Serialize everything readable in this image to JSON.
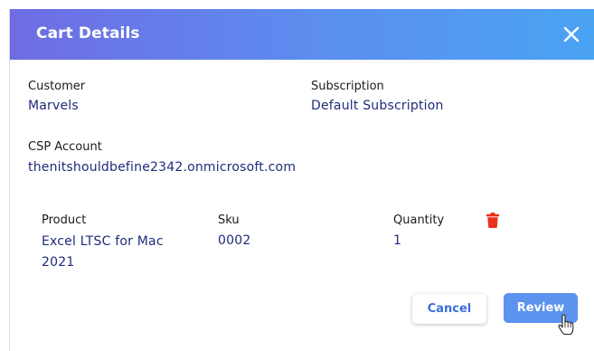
{
  "dialog": {
    "title": "Cart Details",
    "close_icon": "close-icon"
  },
  "customer": {
    "label": "Customer",
    "value": "Marvels"
  },
  "subscription": {
    "label": "Subscription",
    "value": "Default Subscription"
  },
  "csp_account": {
    "label": "CSP Account",
    "value": "thenitshouldbefine2342.onmicrosoft.com"
  },
  "items_table": {
    "headers": {
      "product": "Product",
      "sku": "Sku",
      "quantity": "Quantity"
    },
    "rows": [
      {
        "product": "Excel LTSC for Mac 2021",
        "sku": "0002",
        "quantity": "1",
        "delete_icon": "trash-icon"
      }
    ]
  },
  "actions": {
    "cancel_label": "Cancel",
    "review_label": "Review"
  },
  "colors": {
    "header_gradient_start": "#6f6ce3",
    "header_gradient_end": "#4aa3f3",
    "value_text": "#1f2b7a",
    "primary_button": "#5b93ee",
    "delete_icon": "#e8321e"
  }
}
